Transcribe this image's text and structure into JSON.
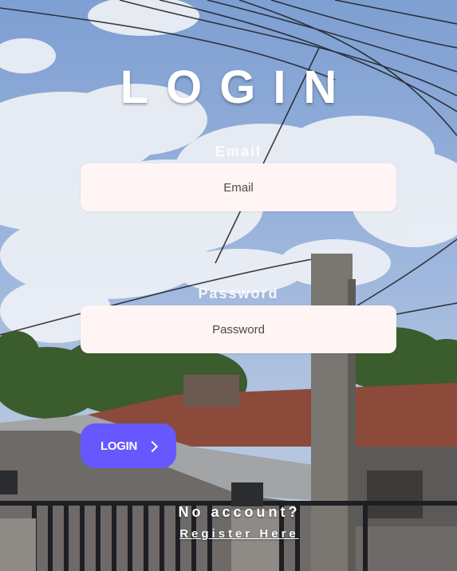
{
  "page": {
    "title": "LOGIN"
  },
  "form": {
    "email": {
      "label": "Email",
      "placeholder": "Email",
      "value": ""
    },
    "password": {
      "label": "Password",
      "placeholder": "Password",
      "value": ""
    },
    "login_button": {
      "label": "LOGIN",
      "icon": "chevron-right-icon"
    }
  },
  "footer": {
    "no_account_text": "No account?",
    "register_link": "Register Here"
  },
  "colors": {
    "button_background": "#6657ff",
    "input_background": "#fff5f5",
    "text": "#ffffff"
  }
}
